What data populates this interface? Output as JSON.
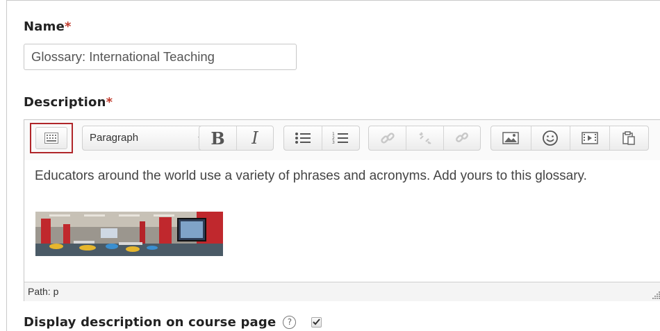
{
  "form": {
    "name_label": "Name",
    "required_mark": "*",
    "name_value": "Glossary: International Teaching",
    "description_label": "Description",
    "display_label": "Display description on course page",
    "help_glyph": "?",
    "display_checked": true
  },
  "editor": {
    "format_select": "Paragraph",
    "bold_glyph": "B",
    "italic_glyph": "I",
    "content_text": "Educators around the world use a variety of phrases and acronyms. Add yours to this glossary.",
    "path_text": "Path: p",
    "toolbar_icons": [
      "kitchen-sink-toggle-icon",
      "bold-icon",
      "italic-icon",
      "unordered-list-icon",
      "ordered-list-icon",
      "link-icon",
      "unlink-icon",
      "anchor-icon",
      "insert-image-icon",
      "emoticon-icon",
      "insert-media-icon",
      "paste-icon"
    ]
  },
  "colors": {
    "required": "#c0392b",
    "highlight": "#b0262a"
  }
}
